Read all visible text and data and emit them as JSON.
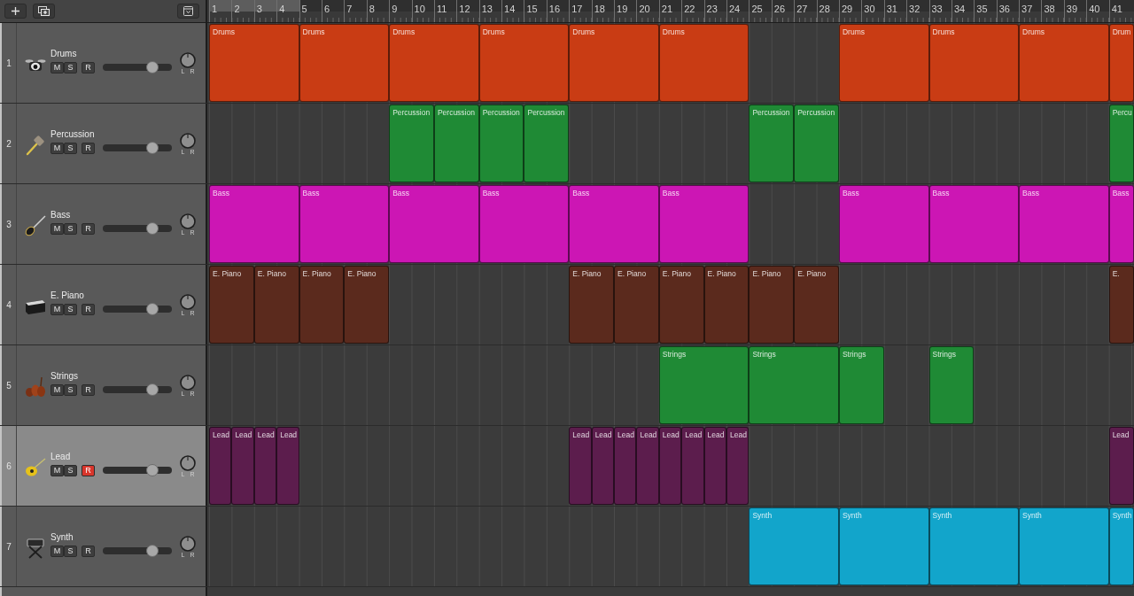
{
  "ruler": {
    "bars": [
      {
        "label": "1",
        "in_cycle": true
      },
      {
        "label": "2",
        "in_cycle": true
      },
      {
        "label": "3",
        "in_cycle": true
      },
      {
        "label": "4",
        "in_cycle": true
      },
      {
        "label": "5",
        "in_cycle": false
      },
      {
        "label": "6",
        "in_cycle": false
      },
      {
        "label": "7",
        "in_cycle": false
      },
      {
        "label": "8",
        "in_cycle": false
      },
      {
        "label": "9",
        "in_cycle": false
      },
      {
        "label": "10",
        "in_cycle": false
      },
      {
        "label": "11",
        "in_cycle": false
      },
      {
        "label": "12",
        "in_cycle": false
      },
      {
        "label": "13",
        "in_cycle": false
      },
      {
        "label": "14",
        "in_cycle": false
      },
      {
        "label": "15",
        "in_cycle": false
      },
      {
        "label": "16",
        "in_cycle": false
      },
      {
        "label": "17",
        "in_cycle": false
      },
      {
        "label": "18",
        "in_cycle": false
      },
      {
        "label": "19",
        "in_cycle": false
      },
      {
        "label": "20",
        "in_cycle": false
      },
      {
        "label": "21",
        "in_cycle": false
      },
      {
        "label": "22",
        "in_cycle": false
      },
      {
        "label": "23",
        "in_cycle": false
      },
      {
        "label": "24",
        "in_cycle": false
      },
      {
        "label": "25",
        "in_cycle": false
      },
      {
        "label": "26",
        "in_cycle": false
      },
      {
        "label": "27",
        "in_cycle": false
      },
      {
        "label": "28",
        "in_cycle": false
      },
      {
        "label": "29",
        "in_cycle": false
      },
      {
        "label": "30",
        "in_cycle": false
      },
      {
        "label": "31",
        "in_cycle": false
      },
      {
        "label": "32",
        "in_cycle": false
      },
      {
        "label": "33",
        "in_cycle": false
      },
      {
        "label": "34",
        "in_cycle": false
      },
      {
        "label": "35",
        "in_cycle": false
      },
      {
        "label": "36",
        "in_cycle": false
      },
      {
        "label": "37",
        "in_cycle": false
      },
      {
        "label": "38",
        "in_cycle": false
      },
      {
        "label": "39",
        "in_cycle": false
      },
      {
        "label": "40",
        "in_cycle": false
      },
      {
        "label": "41",
        "in_cycle": false
      }
    ]
  },
  "tracks": [
    {
      "number": "1",
      "name": "Drums",
      "color": "#c93c14",
      "selected": false,
      "buttons": [
        {
          "kind": "mute",
          "label": "M",
          "on": false
        },
        {
          "kind": "solo",
          "label": "S",
          "on": false
        },
        {
          "kind": "record",
          "label": "R",
          "on": false
        }
      ],
      "volume": {
        "level": 0.72
      },
      "pan": {
        "left": "L",
        "right": "R"
      },
      "lane": [
        {
          "kind": "region",
          "label": "Drums"
        },
        {
          "kind": "tail"
        },
        {
          "kind": "tail"
        },
        {
          "kind": "tail"
        },
        {
          "kind": "region",
          "label": "Drums"
        },
        {
          "kind": "tail"
        },
        {
          "kind": "tail"
        },
        {
          "kind": "tail"
        },
        {
          "kind": "region",
          "label": "Drums"
        },
        {
          "kind": "tail"
        },
        {
          "kind": "tail"
        },
        {
          "kind": "tail"
        },
        {
          "kind": "region",
          "label": "Drums"
        },
        {
          "kind": "tail"
        },
        {
          "kind": "tail"
        },
        {
          "kind": "tail"
        },
        {
          "kind": "region",
          "label": "Drums"
        },
        {
          "kind": "tail"
        },
        {
          "kind": "tail"
        },
        {
          "kind": "tail"
        },
        {
          "kind": "region",
          "label": "Drums"
        },
        {
          "kind": "tail"
        },
        {
          "kind": "tail"
        },
        {
          "kind": "tail"
        },
        {
          "kind": "empty"
        },
        {
          "kind": "empty"
        },
        {
          "kind": "empty"
        },
        {
          "kind": "empty"
        },
        {
          "kind": "region",
          "label": "Drums"
        },
        {
          "kind": "tail"
        },
        {
          "kind": "tail"
        },
        {
          "kind": "tail"
        },
        {
          "kind": "region",
          "label": "Drums"
        },
        {
          "kind": "tail"
        },
        {
          "kind": "tail"
        },
        {
          "kind": "tail"
        },
        {
          "kind": "region",
          "label": "Drums"
        },
        {
          "kind": "tail"
        },
        {
          "kind": "tail"
        },
        {
          "kind": "tail"
        },
        {
          "kind": "region",
          "label": "Drum"
        }
      ]
    },
    {
      "number": "2",
      "name": "Percussion",
      "color": "#1f8a35",
      "selected": false,
      "buttons": [
        {
          "kind": "mute",
          "label": "M",
          "on": false
        },
        {
          "kind": "solo",
          "label": "S",
          "on": false
        },
        {
          "kind": "record",
          "label": "R",
          "on": false
        }
      ],
      "volume": {
        "level": 0.72
      },
      "pan": {
        "left": "L",
        "right": "R"
      },
      "lane": [
        {
          "kind": "empty"
        },
        {
          "kind": "empty"
        },
        {
          "kind": "empty"
        },
        {
          "kind": "empty"
        },
        {
          "kind": "empty"
        },
        {
          "kind": "empty"
        },
        {
          "kind": "empty"
        },
        {
          "kind": "empty"
        },
        {
          "kind": "region",
          "label": "Percussion"
        },
        {
          "kind": "tail"
        },
        {
          "kind": "region",
          "label": "Percussion"
        },
        {
          "kind": "tail"
        },
        {
          "kind": "region",
          "label": "Percussion"
        },
        {
          "kind": "tail"
        },
        {
          "kind": "region",
          "label": "Percussion"
        },
        {
          "kind": "tail"
        },
        {
          "kind": "empty"
        },
        {
          "kind": "empty"
        },
        {
          "kind": "empty"
        },
        {
          "kind": "empty"
        },
        {
          "kind": "empty"
        },
        {
          "kind": "empty"
        },
        {
          "kind": "empty"
        },
        {
          "kind": "empty"
        },
        {
          "kind": "region",
          "label": "Percussion"
        },
        {
          "kind": "tail"
        },
        {
          "kind": "region",
          "label": "Percussion"
        },
        {
          "kind": "tail"
        },
        {
          "kind": "empty"
        },
        {
          "kind": "empty"
        },
        {
          "kind": "empty"
        },
        {
          "kind": "empty"
        },
        {
          "kind": "empty"
        },
        {
          "kind": "empty"
        },
        {
          "kind": "empty"
        },
        {
          "kind": "empty"
        },
        {
          "kind": "empty"
        },
        {
          "kind": "empty"
        },
        {
          "kind": "empty"
        },
        {
          "kind": "empty"
        },
        {
          "kind": "region",
          "label": "Percu"
        }
      ]
    },
    {
      "number": "3",
      "name": "Bass",
      "color": "#cc16b4",
      "selected": false,
      "buttons": [
        {
          "kind": "mute",
          "label": "M",
          "on": false
        },
        {
          "kind": "solo",
          "label": "S",
          "on": false
        },
        {
          "kind": "record",
          "label": "R",
          "on": false
        }
      ],
      "volume": {
        "level": 0.72
      },
      "pan": {
        "left": "L",
        "right": "R"
      },
      "lane": [
        {
          "kind": "region",
          "label": "Bass"
        },
        {
          "kind": "tail"
        },
        {
          "kind": "tail"
        },
        {
          "kind": "tail"
        },
        {
          "kind": "region",
          "label": "Bass"
        },
        {
          "kind": "tail"
        },
        {
          "kind": "tail"
        },
        {
          "kind": "tail"
        },
        {
          "kind": "region",
          "label": "Bass"
        },
        {
          "kind": "tail"
        },
        {
          "kind": "tail"
        },
        {
          "kind": "tail"
        },
        {
          "kind": "region",
          "label": "Bass"
        },
        {
          "kind": "tail"
        },
        {
          "kind": "tail"
        },
        {
          "kind": "tail"
        },
        {
          "kind": "region",
          "label": "Bass"
        },
        {
          "kind": "tail"
        },
        {
          "kind": "tail"
        },
        {
          "kind": "tail"
        },
        {
          "kind": "region",
          "label": "Bass"
        },
        {
          "kind": "tail"
        },
        {
          "kind": "tail"
        },
        {
          "kind": "tail"
        },
        {
          "kind": "empty"
        },
        {
          "kind": "empty"
        },
        {
          "kind": "empty"
        },
        {
          "kind": "empty"
        },
        {
          "kind": "region",
          "label": "Bass"
        },
        {
          "kind": "tail"
        },
        {
          "kind": "tail"
        },
        {
          "kind": "tail"
        },
        {
          "kind": "region",
          "label": "Bass"
        },
        {
          "kind": "tail"
        },
        {
          "kind": "tail"
        },
        {
          "kind": "tail"
        },
        {
          "kind": "region",
          "label": "Bass"
        },
        {
          "kind": "tail"
        },
        {
          "kind": "tail"
        },
        {
          "kind": "tail"
        },
        {
          "kind": "region",
          "label": "Bass"
        }
      ]
    },
    {
      "number": "4",
      "name": "E. Piano",
      "color": "#5b2a1d",
      "selected": false,
      "buttons": [
        {
          "kind": "mute",
          "label": "M",
          "on": false
        },
        {
          "kind": "solo",
          "label": "S",
          "on": false
        },
        {
          "kind": "record",
          "label": "R",
          "on": false
        }
      ],
      "volume": {
        "level": 0.72
      },
      "pan": {
        "left": "L",
        "right": "R"
      },
      "lane": [
        {
          "kind": "region",
          "label": "E. Piano"
        },
        {
          "kind": "tail"
        },
        {
          "kind": "region",
          "label": "E. Piano"
        },
        {
          "kind": "tail"
        },
        {
          "kind": "region",
          "label": "E. Piano"
        },
        {
          "kind": "tail"
        },
        {
          "kind": "region",
          "label": "E. Piano"
        },
        {
          "kind": "tail"
        },
        {
          "kind": "empty"
        },
        {
          "kind": "empty"
        },
        {
          "kind": "empty"
        },
        {
          "kind": "empty"
        },
        {
          "kind": "empty"
        },
        {
          "kind": "empty"
        },
        {
          "kind": "empty"
        },
        {
          "kind": "empty"
        },
        {
          "kind": "region",
          "label": "E. Piano"
        },
        {
          "kind": "tail"
        },
        {
          "kind": "region",
          "label": "E. Piano"
        },
        {
          "kind": "tail"
        },
        {
          "kind": "region",
          "label": "E. Piano"
        },
        {
          "kind": "tail"
        },
        {
          "kind": "region",
          "label": "E. Piano"
        },
        {
          "kind": "tail"
        },
        {
          "kind": "region",
          "label": "E. Piano"
        },
        {
          "kind": "tail"
        },
        {
          "kind": "region",
          "label": "E. Piano"
        },
        {
          "kind": "tail"
        },
        {
          "kind": "empty"
        },
        {
          "kind": "empty"
        },
        {
          "kind": "empty"
        },
        {
          "kind": "empty"
        },
        {
          "kind": "empty"
        },
        {
          "kind": "empty"
        },
        {
          "kind": "empty"
        },
        {
          "kind": "empty"
        },
        {
          "kind": "empty"
        },
        {
          "kind": "empty"
        },
        {
          "kind": "empty"
        },
        {
          "kind": "empty"
        },
        {
          "kind": "region",
          "label": "E."
        }
      ]
    },
    {
      "number": "5",
      "name": "Strings",
      "color": "#1f8a35",
      "selected": false,
      "buttons": [
        {
          "kind": "mute",
          "label": "M",
          "on": false
        },
        {
          "kind": "solo",
          "label": "S",
          "on": false
        },
        {
          "kind": "record",
          "label": "R",
          "on": false
        }
      ],
      "volume": {
        "level": 0.72
      },
      "pan": {
        "left": "L",
        "right": "R"
      },
      "lane": [
        {
          "kind": "empty"
        },
        {
          "kind": "empty"
        },
        {
          "kind": "empty"
        },
        {
          "kind": "empty"
        },
        {
          "kind": "empty"
        },
        {
          "kind": "empty"
        },
        {
          "kind": "empty"
        },
        {
          "kind": "empty"
        },
        {
          "kind": "empty"
        },
        {
          "kind": "empty"
        },
        {
          "kind": "empty"
        },
        {
          "kind": "empty"
        },
        {
          "kind": "empty"
        },
        {
          "kind": "empty"
        },
        {
          "kind": "empty"
        },
        {
          "kind": "empty"
        },
        {
          "kind": "empty"
        },
        {
          "kind": "empty"
        },
        {
          "kind": "empty"
        },
        {
          "kind": "empty"
        },
        {
          "kind": "region",
          "label": "Strings"
        },
        {
          "kind": "tail"
        },
        {
          "kind": "tail"
        },
        {
          "kind": "tail"
        },
        {
          "kind": "region",
          "label": "Strings"
        },
        {
          "kind": "tail"
        },
        {
          "kind": "tail"
        },
        {
          "kind": "tail"
        },
        {
          "kind": "region",
          "label": "Strings"
        },
        {
          "kind": "tail"
        },
        {
          "kind": "empty"
        },
        {
          "kind": "empty"
        },
        {
          "kind": "region",
          "label": "Strings"
        },
        {
          "kind": "tail"
        },
        {
          "kind": "empty"
        },
        {
          "kind": "empty"
        },
        {
          "kind": "empty"
        },
        {
          "kind": "empty"
        },
        {
          "kind": "empty"
        },
        {
          "kind": "empty"
        },
        {
          "kind": "empty"
        }
      ]
    },
    {
      "number": "6",
      "name": "Lead",
      "color": "#5c1d4d",
      "selected": true,
      "buttons": [
        {
          "kind": "mute",
          "label": "M",
          "on": false
        },
        {
          "kind": "solo",
          "label": "S",
          "on": false
        },
        {
          "kind": "record",
          "label": "R",
          "on": true
        }
      ],
      "volume": {
        "level": 0.72
      },
      "pan": {
        "left": "L",
        "right": "R"
      },
      "lane": [
        {
          "kind": "region",
          "label": "Lead"
        },
        {
          "kind": "region",
          "label": "Lead"
        },
        {
          "kind": "region",
          "label": "Lead"
        },
        {
          "kind": "region",
          "label": "Lead"
        },
        {
          "kind": "empty"
        },
        {
          "kind": "empty"
        },
        {
          "kind": "empty"
        },
        {
          "kind": "empty"
        },
        {
          "kind": "empty"
        },
        {
          "kind": "empty"
        },
        {
          "kind": "empty"
        },
        {
          "kind": "empty"
        },
        {
          "kind": "empty"
        },
        {
          "kind": "empty"
        },
        {
          "kind": "empty"
        },
        {
          "kind": "empty"
        },
        {
          "kind": "region",
          "label": "Lead"
        },
        {
          "kind": "region",
          "label": "Lead"
        },
        {
          "kind": "region",
          "label": "Lead"
        },
        {
          "kind": "region",
          "label": "Lead"
        },
        {
          "kind": "region",
          "label": "Lead"
        },
        {
          "kind": "region",
          "label": "Lead"
        },
        {
          "kind": "region",
          "label": "Lead"
        },
        {
          "kind": "region",
          "label": "Lead"
        },
        {
          "kind": "empty"
        },
        {
          "kind": "empty"
        },
        {
          "kind": "empty"
        },
        {
          "kind": "empty"
        },
        {
          "kind": "empty"
        },
        {
          "kind": "empty"
        },
        {
          "kind": "empty"
        },
        {
          "kind": "empty"
        },
        {
          "kind": "empty"
        },
        {
          "kind": "empty"
        },
        {
          "kind": "empty"
        },
        {
          "kind": "empty"
        },
        {
          "kind": "empty"
        },
        {
          "kind": "empty"
        },
        {
          "kind": "empty"
        },
        {
          "kind": "empty"
        },
        {
          "kind": "region",
          "label": "Lead"
        }
      ]
    },
    {
      "number": "7",
      "name": "Synth",
      "color": "#12a5cb",
      "selected": false,
      "buttons": [
        {
          "kind": "mute",
          "label": "M",
          "on": false
        },
        {
          "kind": "solo",
          "label": "S",
          "on": false
        },
        {
          "kind": "record",
          "label": "R",
          "on": false
        }
      ],
      "volume": {
        "level": 0.72
      },
      "pan": {
        "left": "L",
        "right": "R"
      },
      "lane": [
        {
          "kind": "empty"
        },
        {
          "kind": "empty"
        },
        {
          "kind": "empty"
        },
        {
          "kind": "empty"
        },
        {
          "kind": "empty"
        },
        {
          "kind": "empty"
        },
        {
          "kind": "empty"
        },
        {
          "kind": "empty"
        },
        {
          "kind": "empty"
        },
        {
          "kind": "empty"
        },
        {
          "kind": "empty"
        },
        {
          "kind": "empty"
        },
        {
          "kind": "empty"
        },
        {
          "kind": "empty"
        },
        {
          "kind": "empty"
        },
        {
          "kind": "empty"
        },
        {
          "kind": "empty"
        },
        {
          "kind": "empty"
        },
        {
          "kind": "empty"
        },
        {
          "kind": "empty"
        },
        {
          "kind": "empty"
        },
        {
          "kind": "empty"
        },
        {
          "kind": "empty"
        },
        {
          "kind": "empty"
        },
        {
          "kind": "region",
          "label": "Synth"
        },
        {
          "kind": "tail"
        },
        {
          "kind": "tail"
        },
        {
          "kind": "tail"
        },
        {
          "kind": "region",
          "label": "Synth"
        },
        {
          "kind": "tail"
        },
        {
          "kind": "tail"
        },
        {
          "kind": "tail"
        },
        {
          "kind": "region",
          "label": "Synth"
        },
        {
          "kind": "tail"
        },
        {
          "kind": "tail"
        },
        {
          "kind": "tail"
        },
        {
          "kind": "region",
          "label": "Synth"
        },
        {
          "kind": "tail"
        },
        {
          "kind": "tail"
        },
        {
          "kind": "tail"
        },
        {
          "kind": "region",
          "label": "Synth"
        }
      ]
    }
  ]
}
